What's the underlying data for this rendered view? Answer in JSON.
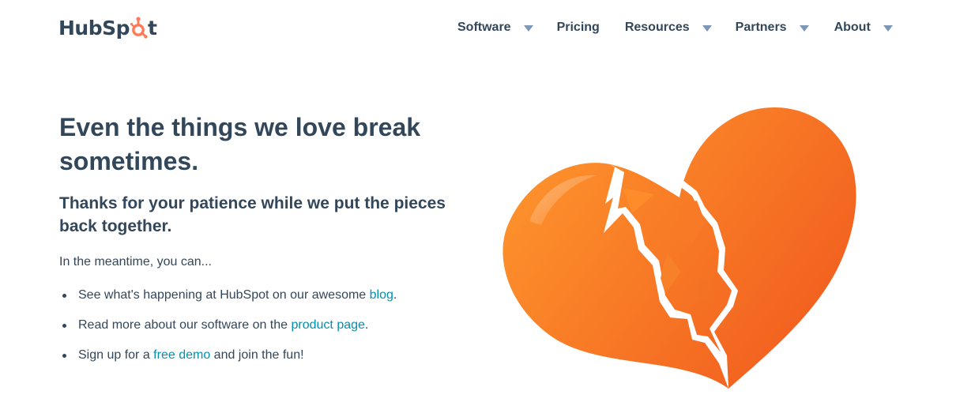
{
  "header": {
    "logo_text_a": "HubSp",
    "logo_text_b": "t",
    "nav": [
      {
        "label": "Software",
        "has_dropdown": true
      },
      {
        "label": "Pricing",
        "has_dropdown": false
      },
      {
        "label": "Resources",
        "has_dropdown": true
      },
      {
        "label": "Partners",
        "has_dropdown": true
      },
      {
        "label": "About",
        "has_dropdown": true
      }
    ]
  },
  "main": {
    "headline": "Even the things we love break sometimes.",
    "subhead": "Thanks for your patience while we put the pieces back together.",
    "intro": "In the meantime, you can...",
    "items": [
      {
        "before": "See what's happening at HubSpot on our awesome ",
        "link": "blog",
        "after": "."
      },
      {
        "before": "Read more about our software on the ",
        "link": "product page",
        "after": "."
      },
      {
        "before": "Sign up for a ",
        "link": "free demo",
        "after": " and join the fun!"
      }
    ]
  },
  "illustration": {
    "icon": "broken-heart-icon"
  },
  "colors": {
    "text": "#33475b",
    "link": "#0091ae",
    "accent": "#ff7a59",
    "heart_light": "#ff9a2e",
    "heart_dark": "#f26522",
    "caret": "#7c98b6"
  }
}
